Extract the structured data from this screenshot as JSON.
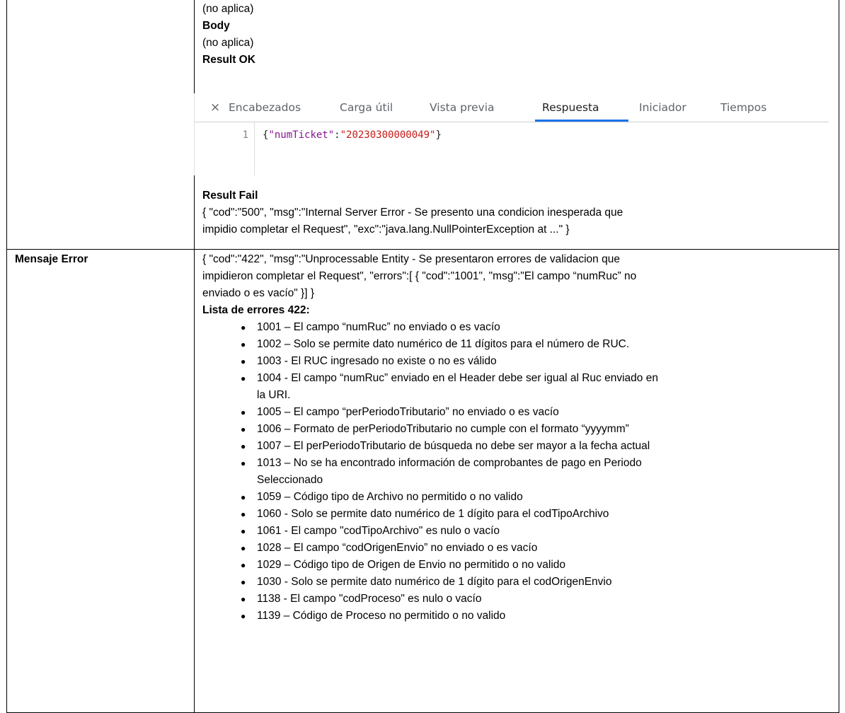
{
  "top_cell": {
    "line1": "(no aplica)",
    "body_heading": "Body",
    "line3": "(no aplica)",
    "result_ok_heading": "Result OK",
    "result_fail_heading": "Result Fail",
    "result_fail_text": [
      "{ \"cod\":\"500\", \"msg\":\"Internal Server Error - Se presento una condicion inesperada que",
      "impidio completar el Request\", \"exc\":\"java.lang.NullPointerException at ...\" }"
    ]
  },
  "devtools": {
    "close_glyph": "×",
    "tabs": [
      "Encabezados",
      "Carga útil",
      "Vista previa",
      "Respuesta",
      "Iniciador",
      "Tiempos"
    ],
    "active_tab": "Respuesta",
    "line_number": "1",
    "code": {
      "open": "{",
      "key": "\"numTicket\"",
      "colon": ":",
      "value": "\"20230300000049\"",
      "close": "}"
    }
  },
  "error_row": {
    "label": "Mensaje Error",
    "text": [
      "{ \"cod\":\"422\", \"msg\":\"Unprocessable Entity - Se presentaron errores de validacion que",
      "impidieron completar el Request\", \"errors\":[ { \"cod\":\"1001\", \"msg\":\"El campo “numRuc” no",
      "enviado o es vacío\" }] }"
    ],
    "list_heading": "Lista de errores 422:",
    "bullet_glyph": "●",
    "errors": [
      [
        "1001 – El campo “numRuc” no enviado o es vacío"
      ],
      [
        "1002 – Solo se permite dato numérico de 11 dígitos para el número de RUC."
      ],
      [
        "1003 - El RUC ingresado no existe o no es válido"
      ],
      [
        "1004 - El campo “numRuc” enviado en el Header debe ser igual al Ruc enviado en",
        "la URI."
      ],
      [
        "1005 – El campo “perPeriodoTributario” no enviado o es vacío"
      ],
      [
        "1006 – Formato de perPeriodoTributario no cumple con el formato “yyyymm”"
      ],
      [
        "1007 – El perPeriodoTributario de búsqueda no debe ser mayor a la fecha actual"
      ],
      [
        "1013 – No se ha encontrado información de comprobantes de pago en Periodo",
        "Seleccionado"
      ],
      [
        "1059 – Código tipo de Archivo no permitido o no valido"
      ],
      [
        "1060 - Solo se permite dato numérico de 1 dígito para el codTipoArchivo"
      ],
      [
        "1061 - El campo \"codTipoArchivo\" es nulo o vacío"
      ],
      [
        "1028 – El campo “codOrigenEnvio” no enviado o es vacío"
      ],
      [
        "1029 – Código tipo de Origen de Envio no permitido o no valido"
      ],
      [
        "1030 - Solo se permite dato numérico de 1 dígito para el codOrigenEnvio"
      ],
      [
        "1138 - El campo \"codProceso\" es nulo o vacío"
      ],
      [
        "1139 – Código de Proceso no permitido o no valido"
      ]
    ]
  }
}
